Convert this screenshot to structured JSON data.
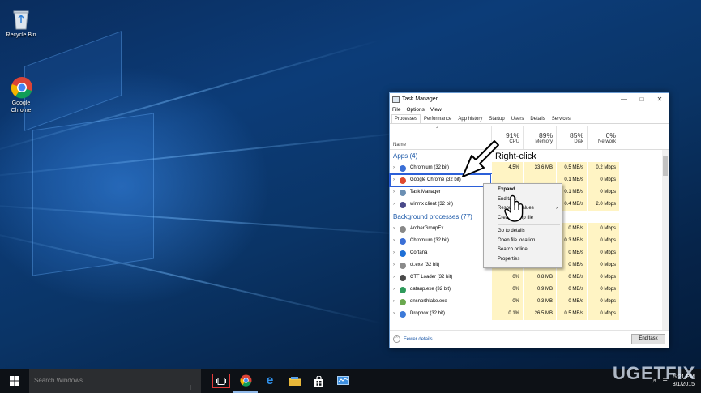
{
  "desktop": {
    "icons": [
      {
        "label": "Recycle Bin",
        "icon": "recycle-bin-icon"
      },
      {
        "label": "Google\nChrome",
        "icon": "chrome-icon"
      }
    ]
  },
  "task_manager": {
    "title": "Task Manager",
    "menu": [
      "File",
      "Options",
      "View"
    ],
    "tabs": [
      "Processes",
      "Performance",
      "App history",
      "Startup",
      "Users",
      "Details",
      "Services"
    ],
    "active_tab": "Processes",
    "columns": {
      "name": "Name",
      "cpu": {
        "pct": "91%",
        "label": "CPU"
      },
      "memory": {
        "pct": "89%",
        "label": "Memory"
      },
      "disk": {
        "pct": "85%",
        "label": "Disk"
      },
      "network": {
        "pct": "0%",
        "label": "Network"
      }
    },
    "apps_header": "Apps (4)",
    "apps": [
      {
        "name": "Chromium (32 bit)",
        "cpu": "4.5%",
        "mem": "33.6 MB",
        "disk": "0.5 MB/s",
        "net": "0.2 Mbps",
        "color": "#3b6fd6"
      },
      {
        "name": "Google Chrome (32 bit)",
        "cpu": "",
        "mem": "",
        "disk": "0.1 MB/s",
        "net": "0 Mbps",
        "color": "#e04a2f"
      },
      {
        "name": "Task Manager",
        "cpu": "",
        "mem": "",
        "disk": "0.1 MB/s",
        "net": "0 Mbps",
        "color": "#6b8fb3"
      },
      {
        "name": "winmx client (32 bit)",
        "cpu": "",
        "mem": "",
        "disk": "0.4 MB/s",
        "net": "2.0 Mbps",
        "color": "#4a4a8a"
      }
    ],
    "bg_header": "Background processes (77)",
    "background": [
      {
        "name": "ArcherGroupEx",
        "cpu": "",
        "mem": "",
        "disk": "0 MB/s",
        "net": "0 Mbps",
        "color": "#888888"
      },
      {
        "name": "Chromium (32 bit)",
        "cpu": "",
        "mem": "",
        "disk": "0.3 MB/s",
        "net": "0 Mbps",
        "color": "#3b6fd6"
      },
      {
        "name": "Cortana",
        "cpu": "",
        "mem": "",
        "disk": "0 MB/s",
        "net": "0 Mbps",
        "color": "#1e6fd6"
      },
      {
        "name": "ct.exe (32 bit)",
        "cpu": "0%",
        "mem": "1.2 MB",
        "disk": "0 MB/s",
        "net": "0 Mbps",
        "color": "#8a8a8a"
      },
      {
        "name": "CTF Loader (32 bit)",
        "cpu": "0%",
        "mem": "0.8 MB",
        "disk": "0 MB/s",
        "net": "0 Mbps",
        "color": "#4a4a4a"
      },
      {
        "name": "dataup.exe (32 bit)",
        "cpu": "0%",
        "mem": "0.9 MB",
        "disk": "0 MB/s",
        "net": "0 Mbps",
        "color": "#2e9a5b"
      },
      {
        "name": "dnsnorthlake.exe",
        "cpu": "0%",
        "mem": "0.3 MB",
        "disk": "0 MB/s",
        "net": "0 Mbps",
        "color": "#6aa84f"
      },
      {
        "name": "Dropbox (32 bit)",
        "cpu": "0.1%",
        "mem": "26.5 MB",
        "disk": "0.5 MB/s",
        "net": "0 Mbps",
        "color": "#3d7ad8"
      }
    ],
    "fewer_details": "Fewer details",
    "end_task": "End task"
  },
  "context_menu": {
    "items": [
      "Expand",
      "End task",
      "Resource values",
      "Create dump file",
      "Go to details",
      "Open file location",
      "Search online",
      "Properties"
    ]
  },
  "annotation": {
    "callout": "Right-click"
  },
  "taskbar": {
    "search_placeholder": "Search Windows",
    "clock_time": "5:21 PM",
    "clock_date": "8/1/2015"
  },
  "watermark": "UGETFIX"
}
